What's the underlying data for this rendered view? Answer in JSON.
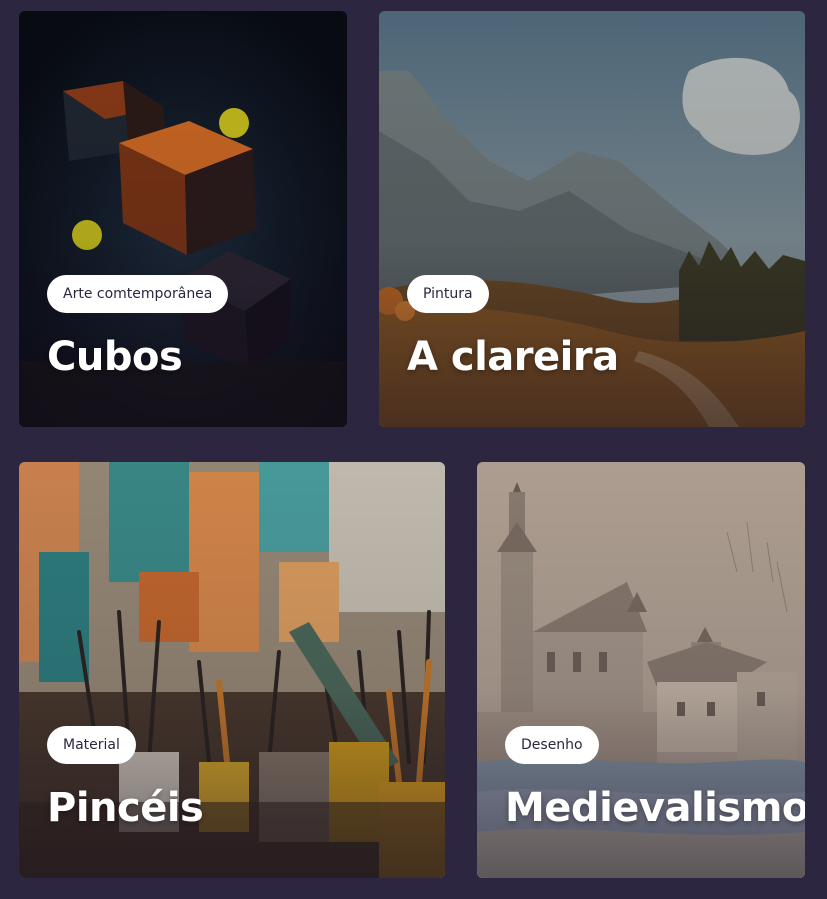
{
  "cards": [
    {
      "tag": "Arte comtemporânea",
      "title": "Cubos"
    },
    {
      "tag": "Pintura",
      "title": "A clareira"
    },
    {
      "tag": "Material",
      "title": "Pincéis"
    },
    {
      "tag": "Desenho",
      "title": "Medievalismo"
    }
  ]
}
